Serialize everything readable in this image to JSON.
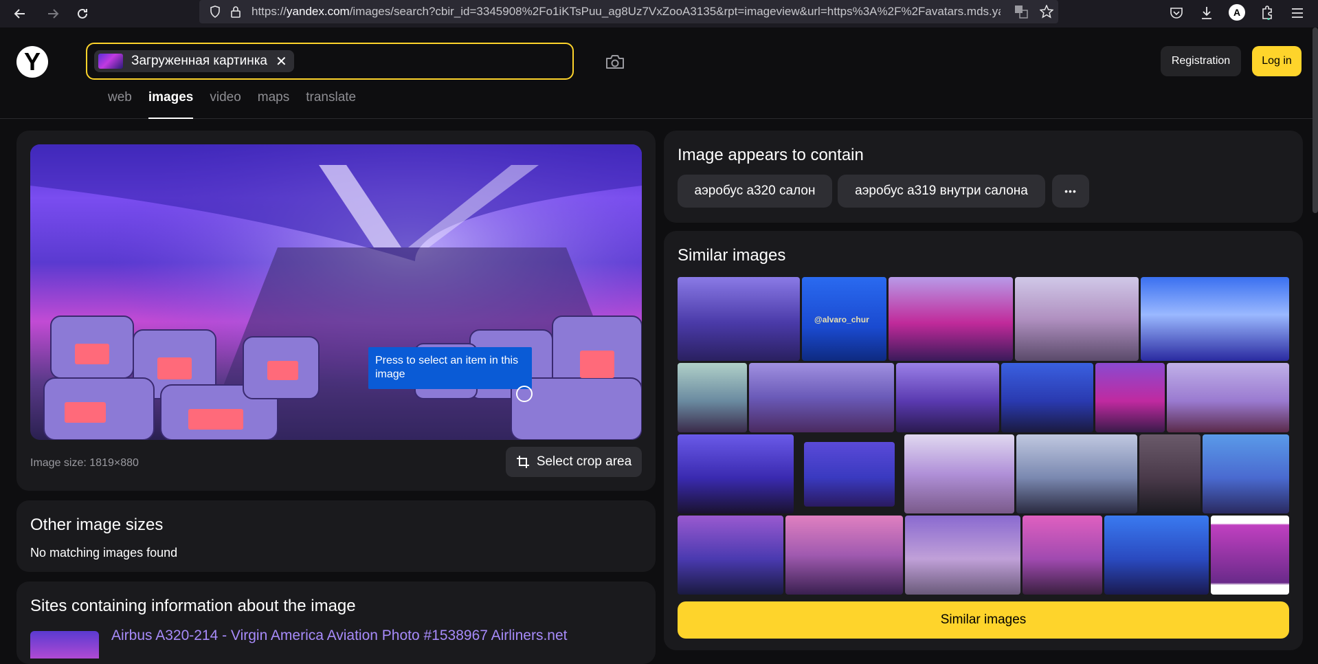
{
  "browser": {
    "url_prefix": "https://",
    "url_host": "yandex.com",
    "url_rest": "/images/search?cbir_id=3345908%2Fo1iKTsPuu_ag8Uz7VxZooA3135&rpt=imageview&url=https%3A%2F%2Favatars.mds.yan",
    "profile_letter": "A"
  },
  "header": {
    "logo": "Y",
    "search_chip_label": "Загруженная картинка",
    "registration_label": "Registration",
    "login_label": "Log in",
    "tabs": [
      {
        "label": "web"
      },
      {
        "label": "images"
      },
      {
        "label": "video"
      },
      {
        "label": "maps"
      },
      {
        "label": "translate"
      }
    ]
  },
  "image_panel": {
    "tooltip": "Press to select an item in this image",
    "image_size": "Image size: 1819×880",
    "crop_label": "Select crop area"
  },
  "other_sizes": {
    "title": "Other image sizes",
    "message": "No matching images found"
  },
  "sites": {
    "title": "Sites containing information about the image",
    "first_link": "Airbus A320-214 - Virgin America Aviation Photo #1538967 Airliners.net"
  },
  "contains": {
    "title": "Image appears to contain",
    "tags": [
      "аэробус а320 салон",
      "аэробус а319 внутри салона"
    ],
    "more": "•••"
  },
  "similar": {
    "title": "Similar images",
    "button_label": "Similar images",
    "watermark": "@alvaro_chur"
  },
  "colors": {
    "accent": "#fed42b",
    "background": "#0e0e10",
    "card": "#1a1a1d",
    "link": "#a78bfa"
  }
}
